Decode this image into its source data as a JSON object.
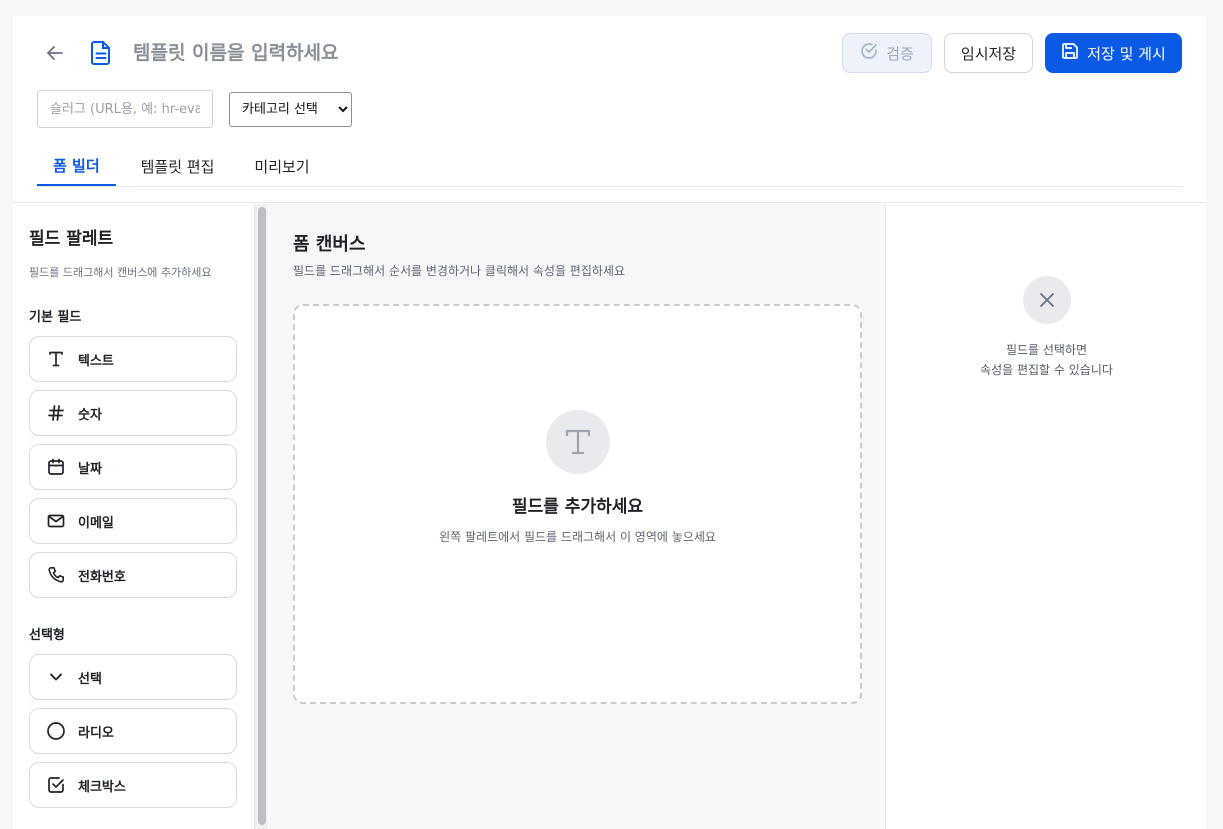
{
  "header": {
    "title_placeholder": "템플릿 이름을 입력하세요",
    "verify_label": "검증",
    "draft_label": "임시저장",
    "save_label": "저장 및 게시",
    "slug_placeholder": "슬러그 (URL용, 예: hr-eva",
    "category_selected": "카테고리 선택"
  },
  "tabs": [
    {
      "label": "폼 빌더",
      "active": true
    },
    {
      "label": "템플릿 편집",
      "active": false
    },
    {
      "label": "미리보기",
      "active": false
    }
  ],
  "sidebar": {
    "title": "필드 팔레트",
    "subtitle": "필드를 드래그해서 캔버스에 추가하세요",
    "groups": [
      {
        "label": "기본 필드",
        "items": [
          {
            "label": "텍스트",
            "icon": "text-icon"
          },
          {
            "label": "숫자",
            "icon": "hash-icon"
          },
          {
            "label": "날짜",
            "icon": "calendar-icon"
          },
          {
            "label": "이메일",
            "icon": "mail-icon"
          },
          {
            "label": "전화번호",
            "icon": "phone-icon"
          }
        ]
      },
      {
        "label": "선택형",
        "items": [
          {
            "label": "선택",
            "icon": "chevron-down-icon"
          },
          {
            "label": "라디오",
            "icon": "circle-icon"
          },
          {
            "label": "체크박스",
            "icon": "checkbox-icon"
          }
        ]
      }
    ]
  },
  "canvas": {
    "title": "폼 캔버스",
    "subtitle": "필드를 드래그해서 순서를 변경하거나 클릭해서 속성을 편집하세요",
    "empty_title": "필드를 추가하세요",
    "empty_subtitle": "왼쪽 팔레트에서 필드를 드래그해서 이 영역에 놓으세요"
  },
  "properties": {
    "line1": "필드를 선택하면",
    "line2": "속성을 편집할 수 있습니다"
  },
  "colors": {
    "accent": "#0b5ae6",
    "border": "#d7dbe0",
    "muted_text": "#5f6670"
  }
}
